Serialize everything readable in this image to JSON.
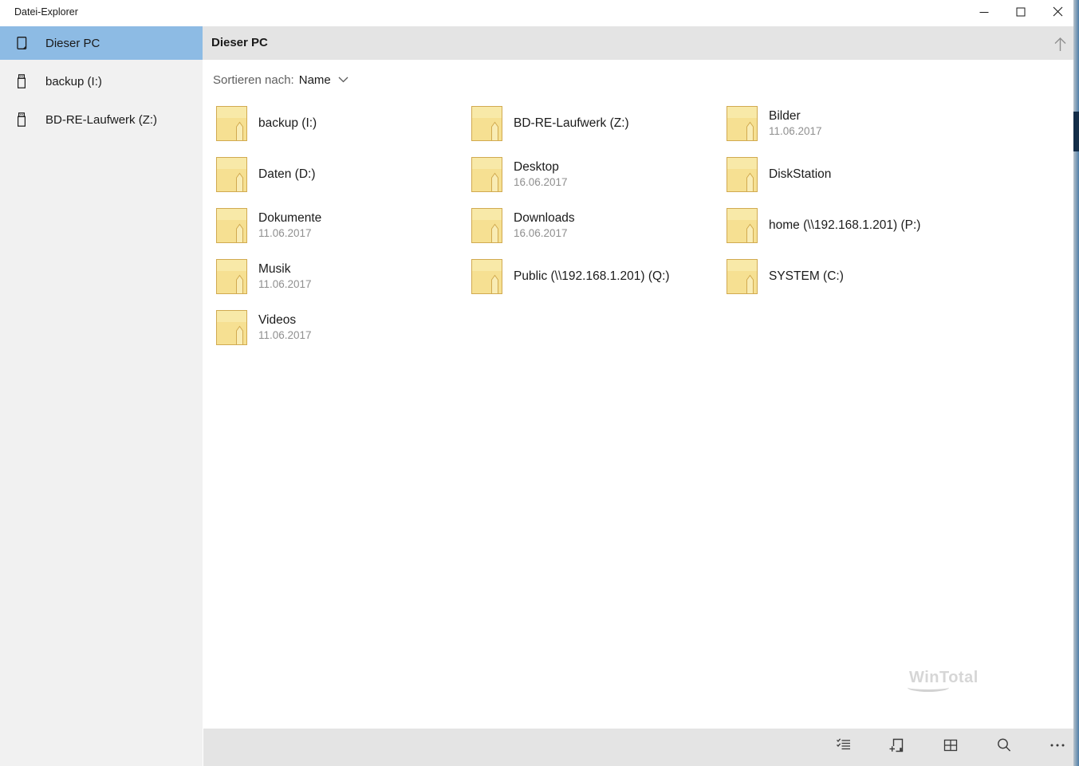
{
  "window": {
    "title": "Datei-Explorer",
    "controls": [
      {
        "name": "minimize-button",
        "icon": "minimize-icon"
      },
      {
        "name": "maximize-button",
        "icon": "maximize-icon"
      },
      {
        "name": "close-button",
        "icon": "close-icon"
      }
    ]
  },
  "sidebar": {
    "items": [
      {
        "label": "Dieser PC",
        "icon": "pc-icon",
        "selected": true
      },
      {
        "label": "backup (I:)",
        "icon": "usb-drive-icon",
        "selected": false
      },
      {
        "label": "BD-RE-Laufwerk (Z:)",
        "icon": "usb-drive-icon",
        "selected": false
      }
    ]
  },
  "header": {
    "title": "Dieser PC",
    "up_icon": "up-arrow-icon"
  },
  "sort": {
    "label": "Sortieren nach:",
    "value": "Name",
    "chevron_icon": "chevron-down-icon"
  },
  "folders": [
    {
      "name": "backup (I:)",
      "date": ""
    },
    {
      "name": "BD-RE-Laufwerk (Z:)",
      "date": ""
    },
    {
      "name": "Bilder",
      "date": "11.06.2017"
    },
    {
      "name": "Daten (D:)",
      "date": ""
    },
    {
      "name": "Desktop",
      "date": "16.06.2017"
    },
    {
      "name": "DiskStation",
      "date": ""
    },
    {
      "name": "Dokumente",
      "date": "11.06.2017"
    },
    {
      "name": "Downloads",
      "date": "16.06.2017"
    },
    {
      "name": "home (\\\\192.168.1.201) (P:)",
      "date": ""
    },
    {
      "name": "Musik",
      "date": "11.06.2017"
    },
    {
      "name": "Public (\\\\192.168.1.201) (Q:)",
      "date": ""
    },
    {
      "name": "SYSTEM (C:)",
      "date": ""
    },
    {
      "name": "Videos",
      "date": "11.06.2017"
    }
  ],
  "toolbar": {
    "buttons": [
      {
        "name": "multi-select-button",
        "icon": "multi-select-icon"
      },
      {
        "name": "new-folder-button",
        "icon": "new-folder-icon"
      },
      {
        "name": "grid-view-button",
        "icon": "grid-view-icon"
      },
      {
        "name": "search-button",
        "icon": "search-icon"
      },
      {
        "name": "more-button",
        "icon": "more-icon"
      }
    ]
  },
  "watermark": "WinTotal",
  "colors": {
    "selection_blue": "#8dbbe4",
    "band_gray": "#e4e4e4",
    "sidebar_gray": "#f1f1f1",
    "folder_yellow": "#f6e092",
    "folder_border": "#d1aa50",
    "date_gray": "#8f8f8f"
  }
}
